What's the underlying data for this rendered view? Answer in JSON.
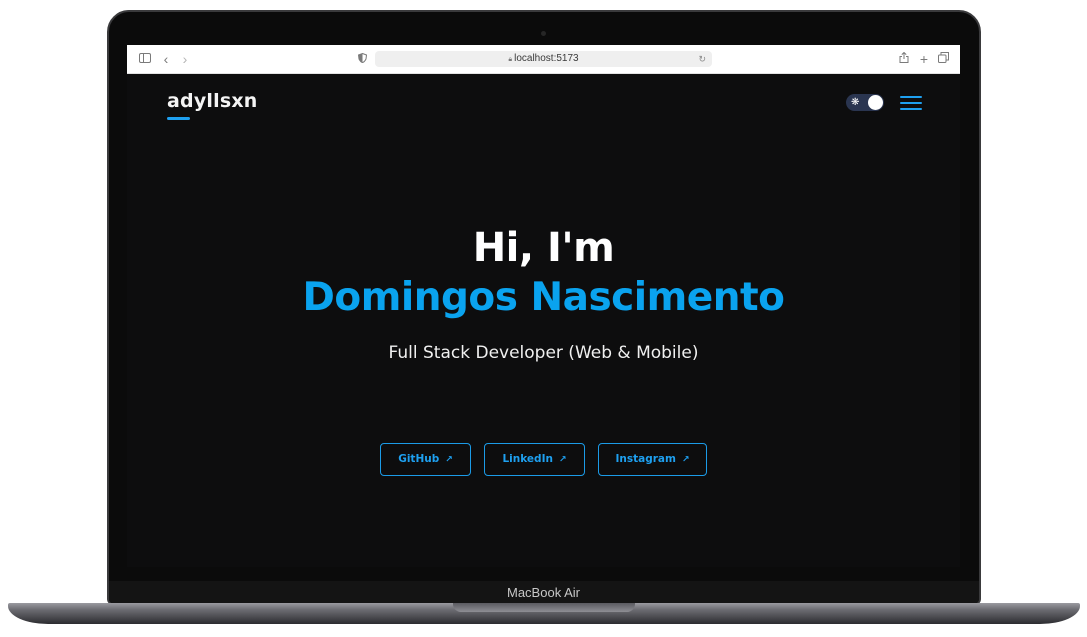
{
  "device": {
    "model_label": "MacBook Air"
  },
  "browser": {
    "url": "localhost:5173",
    "icons": {
      "sidebar": "sidebar-icon",
      "back": "chevron-left-icon",
      "forward": "chevron-right-icon",
      "shield": "shield-icon",
      "lock": "lock-icon",
      "reload": "reload-icon",
      "share": "share-icon",
      "new_tab": "plus-icon",
      "tabs": "tabs-overview-icon"
    }
  },
  "site": {
    "logo": "adyllsxn",
    "theme_toggle": {
      "icon": "sun-icon",
      "state": "dark"
    },
    "menu_icon": "hamburger-menu-icon"
  },
  "hero": {
    "greeting": "Hi, I'm",
    "name": "Domingos Nascimento",
    "role": "Full Stack Developer (Web & Mobile)",
    "links": [
      {
        "label": "GitHub",
        "icon": "external-arrow-icon"
      },
      {
        "label": "LinkedIn",
        "icon": "external-arrow-icon"
      },
      {
        "label": "Instagram",
        "icon": "external-arrow-icon"
      }
    ]
  },
  "colors": {
    "accent": "#0aa3ef",
    "page_background": "#0d0d0e",
    "text": "#ffffff"
  }
}
